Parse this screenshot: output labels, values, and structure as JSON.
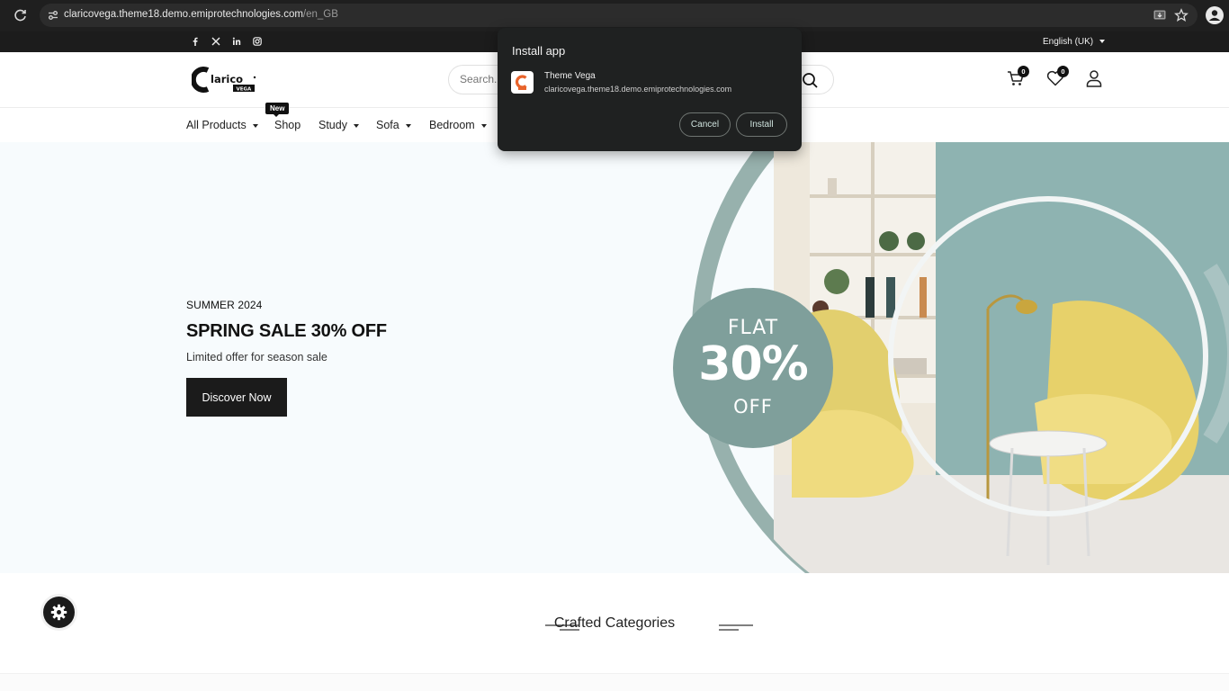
{
  "browser": {
    "url_host": "claricovega.theme18.demo.emiprotechnologies.com",
    "url_path": "/en_GB"
  },
  "topbar": {
    "social_icons": [
      "facebook-icon",
      "x-twitter-icon",
      "linkedin-icon",
      "instagram-icon"
    ],
    "language": "English (UK)"
  },
  "header": {
    "search_placeholder": "Search...",
    "cart_count": "0",
    "wishlist_count": "0"
  },
  "nav": {
    "new_tag": "New",
    "items": [
      {
        "label": "All Products"
      },
      {
        "label": "Shop"
      },
      {
        "label": "Study"
      },
      {
        "label": "Sofa"
      },
      {
        "label": "Bedroom"
      }
    ]
  },
  "hero": {
    "subtitle": "SUMMER 2024",
    "title": "SPRING SALE 30% OFF",
    "description": "Limited offer for season sale",
    "cta_label": "Discover Now",
    "badge_line1": "FLAT",
    "badge_line2": "30%",
    "badge_line3": "OFF"
  },
  "categories": {
    "title": "Crafted Categories"
  },
  "install_popup": {
    "title": "Install app",
    "app_name": "Theme Vega",
    "app_url": "claricovega.theme18.demo.emiprotechnologies.com",
    "cancel_label": "Cancel",
    "install_label": "Install"
  },
  "colors": {
    "accent_teal": "#7f9f9b",
    "dark": "#1b1b1b",
    "logo_orange": "#e8632b"
  }
}
